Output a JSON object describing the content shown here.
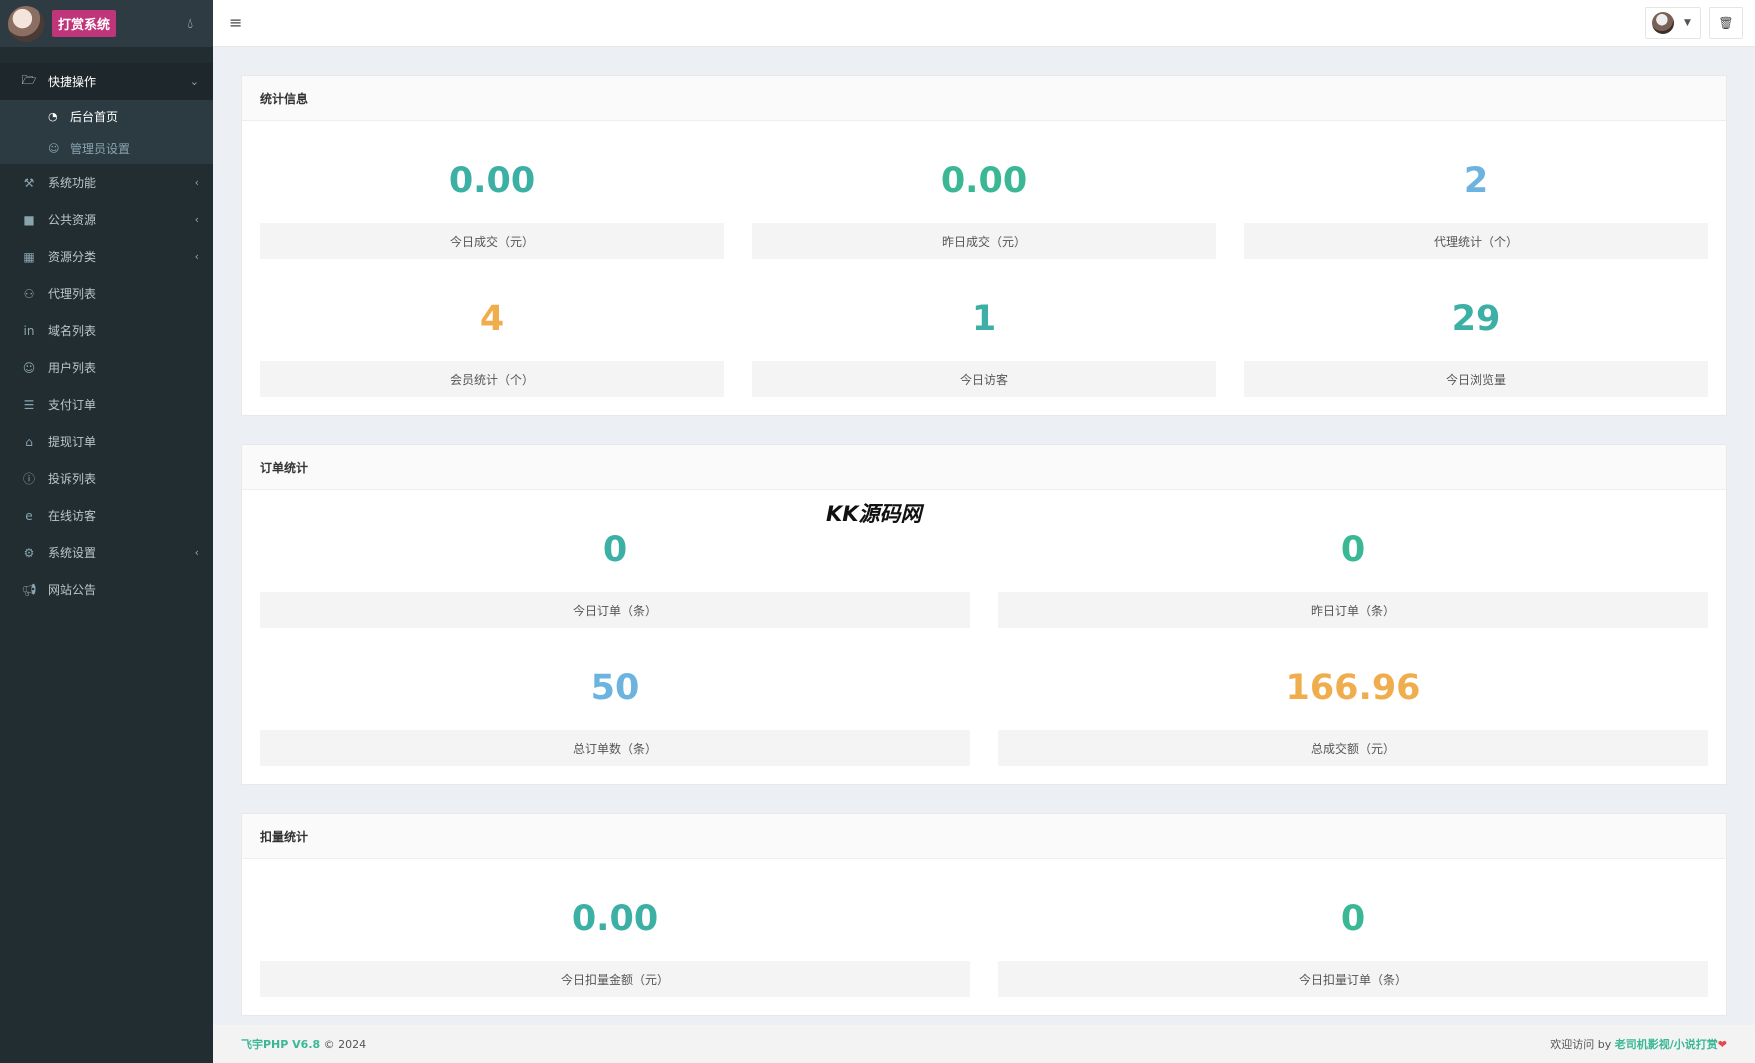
{
  "brand": {
    "title": "打赏系统",
    "drop_icon": "water-drop-icon"
  },
  "sidebar": {
    "items": [
      {
        "label": "快捷操作",
        "icon": "folder-open-icon",
        "active": true,
        "caret": "⌄",
        "children": [
          {
            "label": "后台首页",
            "icon": "dashboard-icon",
            "active": true
          },
          {
            "label": "管理员设置",
            "icon": "user-icon",
            "active": false
          }
        ]
      },
      {
        "label": "系统功能",
        "icon": "wrench-icon",
        "caret": "‹"
      },
      {
        "label": "公共资源",
        "icon": "video-icon",
        "caret": "‹"
      },
      {
        "label": "资源分类",
        "icon": "grid-icon",
        "caret": "‹"
      },
      {
        "label": "代理列表",
        "icon": "users-icon"
      },
      {
        "label": "域名列表",
        "icon": "linkedin-icon"
      },
      {
        "label": "用户列表",
        "icon": "user-icon"
      },
      {
        "label": "支付订单",
        "icon": "list-icon"
      },
      {
        "label": "提现订单",
        "icon": "bank-icon"
      },
      {
        "label": "投诉列表",
        "icon": "info-icon"
      },
      {
        "label": "在线访客",
        "icon": "ie-icon"
      },
      {
        "label": "系统设置",
        "icon": "gear-icon",
        "caret": "‹"
      },
      {
        "label": "网站公告",
        "icon": "megaphone-icon"
      }
    ]
  },
  "header": {
    "menu_icon": "≡",
    "trash_icon": "🗑"
  },
  "panels": {
    "stats": {
      "title": "统计信息",
      "items": [
        {
          "value": "0.00",
          "label": "今日成交（元）",
          "color": "#3cb0a4"
        },
        {
          "value": "0.00",
          "label": "昨日成交（元）",
          "color": "#3ab795"
        },
        {
          "value": "2",
          "label": "代理统计（个）",
          "color": "#6cb3e0"
        },
        {
          "value": "4",
          "label": "会员统计（个）",
          "color": "#f0ad4e"
        },
        {
          "value": "1",
          "label": "今日访客",
          "color": "#3cb0a4"
        },
        {
          "value": "29",
          "label": "今日浏览量",
          "color": "#3cb0a4"
        }
      ]
    },
    "orders": {
      "title": "订单统计",
      "items": [
        {
          "value": "0",
          "label": "今日订单（条）",
          "color": "#3cb0a4"
        },
        {
          "value": "0",
          "label": "昨日订单（条）",
          "color": "#3ab795"
        },
        {
          "value": "50",
          "label": "总订单数（条）",
          "color": "#6cb3e0"
        },
        {
          "value": "166.96",
          "label": "总成交额（元）",
          "color": "#f0ad4e"
        }
      ]
    },
    "deduct": {
      "title": "扣量统计",
      "items": [
        {
          "value": "0.00",
          "label": "今日扣量金额（元）",
          "color": "#3cb0a4"
        },
        {
          "value": "0",
          "label": "今日扣量订单（条）",
          "color": "#3ab795"
        }
      ]
    }
  },
  "watermark": "KK源码网",
  "footer": {
    "version": "飞宇PHP V6.8",
    "copyright": "© 2024",
    "welcome": "欢迎访问 by",
    "link": "老司机影视/小说打赏",
    "heart": "❤"
  }
}
